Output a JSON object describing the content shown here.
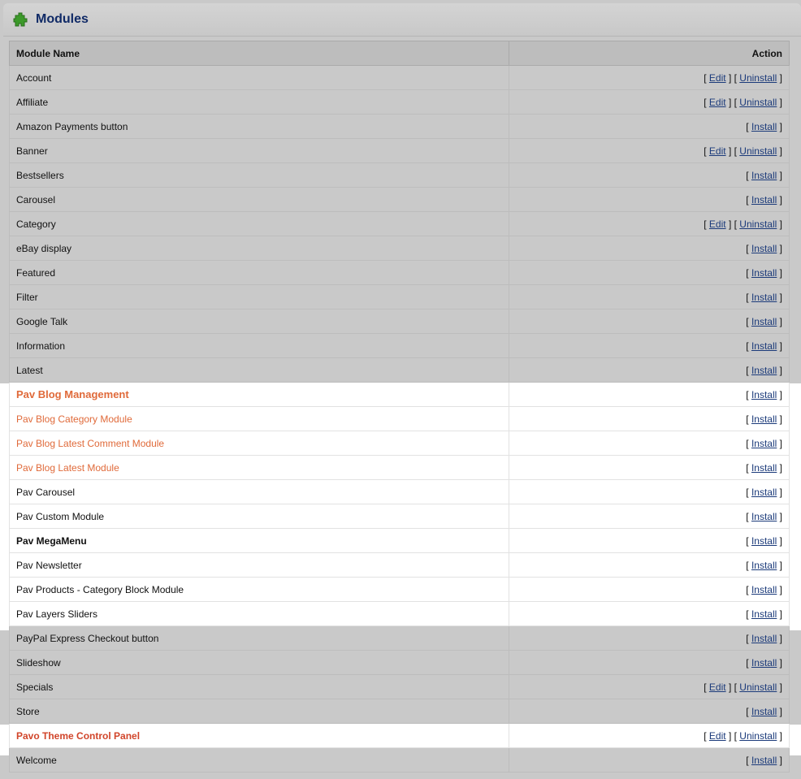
{
  "header": {
    "title": "Modules",
    "icon": "puzzle-icon"
  },
  "table": {
    "columns": {
      "name": "Module Name",
      "action": "Action"
    },
    "rows": [
      {
        "name": "Account",
        "actions": [
          "Edit",
          "Uninstall"
        ],
        "style": "normal"
      },
      {
        "name": "Affiliate",
        "actions": [
          "Edit",
          "Uninstall"
        ],
        "style": "normal"
      },
      {
        "name": "Amazon Payments button",
        "actions": [
          "Install"
        ],
        "style": "normal"
      },
      {
        "name": "Banner",
        "actions": [
          "Edit",
          "Uninstall"
        ],
        "style": "normal"
      },
      {
        "name": "Bestsellers",
        "actions": [
          "Install"
        ],
        "style": "normal"
      },
      {
        "name": "Carousel",
        "actions": [
          "Install"
        ],
        "style": "normal"
      },
      {
        "name": "Category",
        "actions": [
          "Edit",
          "Uninstall"
        ],
        "style": "normal"
      },
      {
        "name": "eBay display",
        "actions": [
          "Install"
        ],
        "style": "normal"
      },
      {
        "name": "Featured",
        "actions": [
          "Install"
        ],
        "style": "normal"
      },
      {
        "name": "Filter",
        "actions": [
          "Install"
        ],
        "style": "normal"
      },
      {
        "name": "Google Talk",
        "actions": [
          "Install"
        ],
        "style": "normal"
      },
      {
        "name": "Information",
        "actions": [
          "Install"
        ],
        "style": "normal"
      },
      {
        "name": "Latest",
        "actions": [
          "Install"
        ],
        "style": "normal"
      },
      {
        "name": "Pav Blog Management",
        "actions": [
          "Install"
        ],
        "style": "orange-big",
        "highlight": true
      },
      {
        "name": "Pav Blog Category Module",
        "actions": [
          "Install"
        ],
        "style": "orange",
        "highlight": true
      },
      {
        "name": "Pav Blog Latest Comment Module",
        "actions": [
          "Install"
        ],
        "style": "orange",
        "highlight": true
      },
      {
        "name": "Pav Blog Latest Module",
        "actions": [
          "Install"
        ],
        "style": "orange",
        "highlight": true
      },
      {
        "name": "Pav Carousel",
        "actions": [
          "Install"
        ],
        "style": "normal",
        "highlight": true
      },
      {
        "name": "Pav Custom Module",
        "actions": [
          "Install"
        ],
        "style": "normal",
        "highlight": true
      },
      {
        "name": "Pav MegaMenu",
        "actions": [
          "Install"
        ],
        "style": "bold",
        "highlight": true
      },
      {
        "name": "Pav Newsletter",
        "actions": [
          "Install"
        ],
        "style": "normal",
        "highlight": true
      },
      {
        "name": "Pav Products - Category Block Module",
        "actions": [
          "Install"
        ],
        "style": "normal",
        "highlight": true
      },
      {
        "name": "Pav Layers Sliders",
        "actions": [
          "Install"
        ],
        "style": "normal",
        "highlight": true
      },
      {
        "name": "PayPal Express Checkout button",
        "actions": [
          "Install"
        ],
        "style": "normal"
      },
      {
        "name": "Slideshow",
        "actions": [
          "Install"
        ],
        "style": "normal"
      },
      {
        "name": "Specials",
        "actions": [
          "Edit",
          "Uninstall"
        ],
        "style": "normal"
      },
      {
        "name": "Store",
        "actions": [
          "Install"
        ],
        "style": "normal"
      },
      {
        "name": "Pavo Theme Control Panel",
        "actions": [
          "Edit",
          "Uninstall"
        ],
        "style": "red",
        "highlight": true
      },
      {
        "name": "Welcome",
        "actions": [
          "Install"
        ],
        "style": "normal"
      }
    ]
  },
  "colors": {
    "title": "#102a66",
    "link": "#1b3a7a",
    "orange": "#e06a3a",
    "red": "#d1452a",
    "highlight_bg": "#ffffff",
    "dim_bg": "#c9c9c9"
  }
}
